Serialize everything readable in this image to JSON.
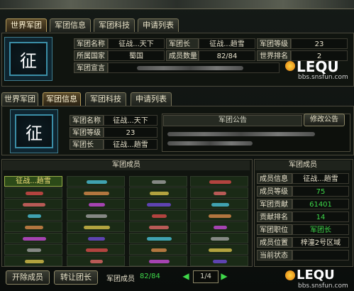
{
  "top_tabs": [
    "世界军团",
    "军团信息",
    "军团科技",
    "申请列表"
  ],
  "emblem_char": "征",
  "top_info": {
    "rows": [
      [
        {
          "l": "军团名称",
          "v": "征战...天下"
        },
        {
          "l": "军团长",
          "v": "征战...趟雪"
        },
        {
          "l": "军团等级",
          "v": "23"
        }
      ],
      [
        {
          "l": "所属国家",
          "v": "蜀国"
        },
        {
          "l": "成员数量",
          "v": "82/84"
        },
        {
          "l": "世界排名",
          "v": "2"
        }
      ]
    ],
    "declaration_label": "军团宣言"
  },
  "watermark": {
    "brand": "LEQU",
    "site": "bbs.snsfun.com"
  },
  "mid_tabs": [
    "世界军团",
    "军团信息",
    "军团科技",
    "申请列表"
  ],
  "mid_info": {
    "rows": [
      {
        "l": "军团名称",
        "v": "征战...天下"
      },
      {
        "l": "军团等级",
        "v": "23"
      },
      {
        "l": "军团长",
        "v": "征战...趟雪"
      }
    ],
    "announcement_title": "军团公告",
    "edit_button": "修改公告"
  },
  "members_title": "军团成员",
  "selected_member": "征战...趟雪",
  "detail": {
    "title": "军团成员",
    "rows": [
      {
        "l": "成员信息",
        "v": "征战...趟雪",
        "green": false
      },
      {
        "l": "成员等级",
        "v": "75",
        "green": true
      },
      {
        "l": "军团贡献",
        "v": "61401",
        "green": true
      },
      {
        "l": "贡献排名",
        "v": "14",
        "green": true
      },
      {
        "l": "军团职位",
        "v": "军团长",
        "green": true
      },
      {
        "l": "成员位置",
        "v": "梓潼2号区域",
        "green": false
      },
      {
        "l": "当前状态",
        "v": "",
        "green": false
      }
    ]
  },
  "footer": {
    "kick_button": "开除成员",
    "transfer_button": "转让团长",
    "members_label": "军团成员",
    "members_count": "82/84",
    "page": "1/4"
  }
}
